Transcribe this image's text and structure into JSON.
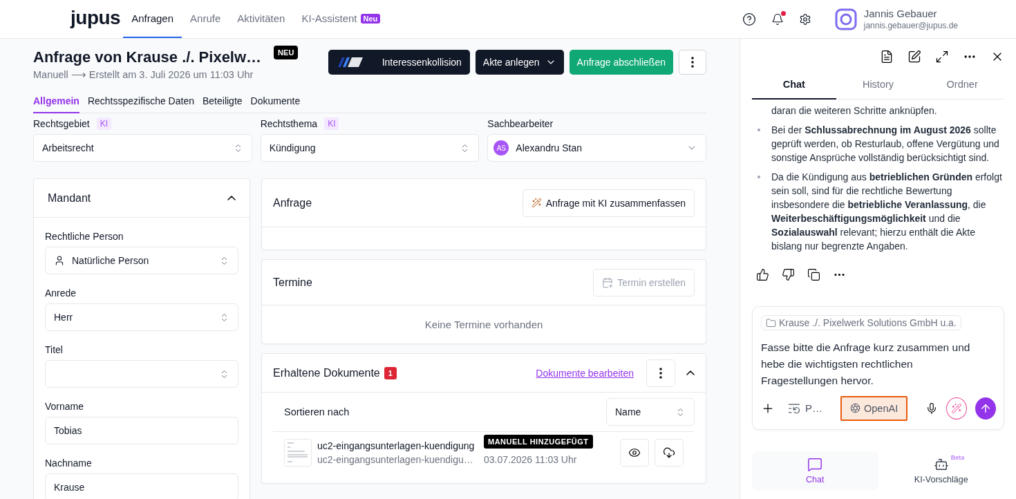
{
  "header": {
    "logo": "jupus",
    "nav": [
      {
        "label": "Anfragen",
        "selected": true
      },
      {
        "label": "Anrufe",
        "selected": false
      },
      {
        "label": "Aktivitäten",
        "selected": false
      },
      {
        "label": "KI-Assistent",
        "selected": false,
        "badge": "Neu"
      }
    ],
    "notifications_unread": true,
    "user": {
      "name": "Jannis Gebauer",
      "email": "jannis.gebauer@jupus.de"
    }
  },
  "request": {
    "title": "Anfrage von Krause ./. Pixelw…",
    "status": "NEU",
    "meta": "Manuell ⟶ Erstellt am 3. Juli 2026 um 11:03 Uhr",
    "actions": [
      {
        "kind": "brand",
        "label": "Interessenkollision"
      },
      {
        "kind": "dropdown",
        "label": "Akte anlegen"
      },
      {
        "kind": "primary",
        "label": "Anfrage abschließen"
      },
      {
        "kind": "more"
      }
    ]
  },
  "tabs": [
    {
      "label": "Allgemein",
      "selected": true
    },
    {
      "label": "Rechtsspezifische Daten",
      "selected": false
    },
    {
      "label": "Beteiligte",
      "selected": false
    },
    {
      "label": "Dokumente",
      "selected": false
    }
  ],
  "top_fields": [
    {
      "kind": "select",
      "label": "Rechtsgebiet",
      "badge": "KI",
      "value": "Arbeitsrecht"
    },
    {
      "kind": "select",
      "label": "Rechtsthema",
      "badge": "KI",
      "value": "Kündigung"
    },
    {
      "kind": "person",
      "label": "Sachbearbeiter",
      "initials": "AS",
      "value": "Alexandru Stan"
    }
  ],
  "mandant": {
    "title": "Mandant",
    "expanded": true,
    "fields": [
      {
        "kind": "person_select",
        "label": "Rechtliche Person",
        "value": "Natürliche Person"
      },
      {
        "kind": "select",
        "label": "Anrede",
        "value": "Herr"
      },
      {
        "kind": "select",
        "label": "Titel"
      },
      {
        "kind": "input",
        "label": "Vorname",
        "value": "Tobias"
      },
      {
        "kind": "input",
        "label": "Nachname",
        "value": "Krause"
      }
    ]
  },
  "anfrage": {
    "title": "Anfrage",
    "summarize_button": "Anfrage mit KI zusammenfassen"
  },
  "termine": {
    "title": "Termine",
    "create_button": {
      "label": "Termin erstellen",
      "disabled": true
    },
    "empty": "Keine Termine vorhanden"
  },
  "documents": {
    "title": "Erhaltene Dokumente",
    "count": "1",
    "edit_link": "Dokumente bearbeiten",
    "expanded": true,
    "sort_label": "Sortieren nach",
    "sort_value": "Name",
    "files": [
      {
        "name": "uc2-eingangsunterlagen-kuendigung",
        "filename": "uc2-eingangsunterlagen-kuendigu…",
        "tag": "MANUELL HINZUGEFÜGT",
        "date": "03.07.2026 11:03 Uhr"
      }
    ]
  },
  "chat": {
    "tabs": [
      {
        "label": "Chat",
        "selected": true
      },
      {
        "label": "History",
        "selected": false
      },
      {
        "label": "Ordner",
        "selected": false
      }
    ],
    "messages": [
      {
        "kind": "continuation",
        "text": "daran die weiteren Schritte anknüpfen."
      },
      {
        "kind": "bullet",
        "text": "Bei der **Schlussabrechnung im August 2026** sollte geprüft werden, ob Resturlaub, offene Vergütung und sonstige Ansprüche vollständig berücksichtigt sind."
      },
      {
        "kind": "bullet",
        "text": "Da die Kündigung aus **betrieblichen Gründen** erfolgt sein soll, sind für die rechtliche Bewertung insbesondere die **betriebliche Veranlassung**, die **Weiterbeschäftigungsmöglichkeit** und die **Sozialauswahl** relevant; hierzu enthält die Akte bislang nur begrenzte Angaben."
      }
    ],
    "composer": {
      "context": "Krause ./. Pixelwerk Solutions GmbH u.a.",
      "text": "Fasse bitte die Anfrage kurz zusammen und hebe die wichtigsten rechtlichen Fragestellungen hervor.",
      "prompt_label": "P…",
      "model": {
        "label": "OpenAI",
        "selected": true
      }
    },
    "bottom_nav": [
      {
        "kind": "chat",
        "label": "Chat",
        "selected": true
      },
      {
        "kind": "suggestions",
        "label": "KI-Vorschläge",
        "badge": "Beta",
        "selected": false
      }
    ]
  }
}
